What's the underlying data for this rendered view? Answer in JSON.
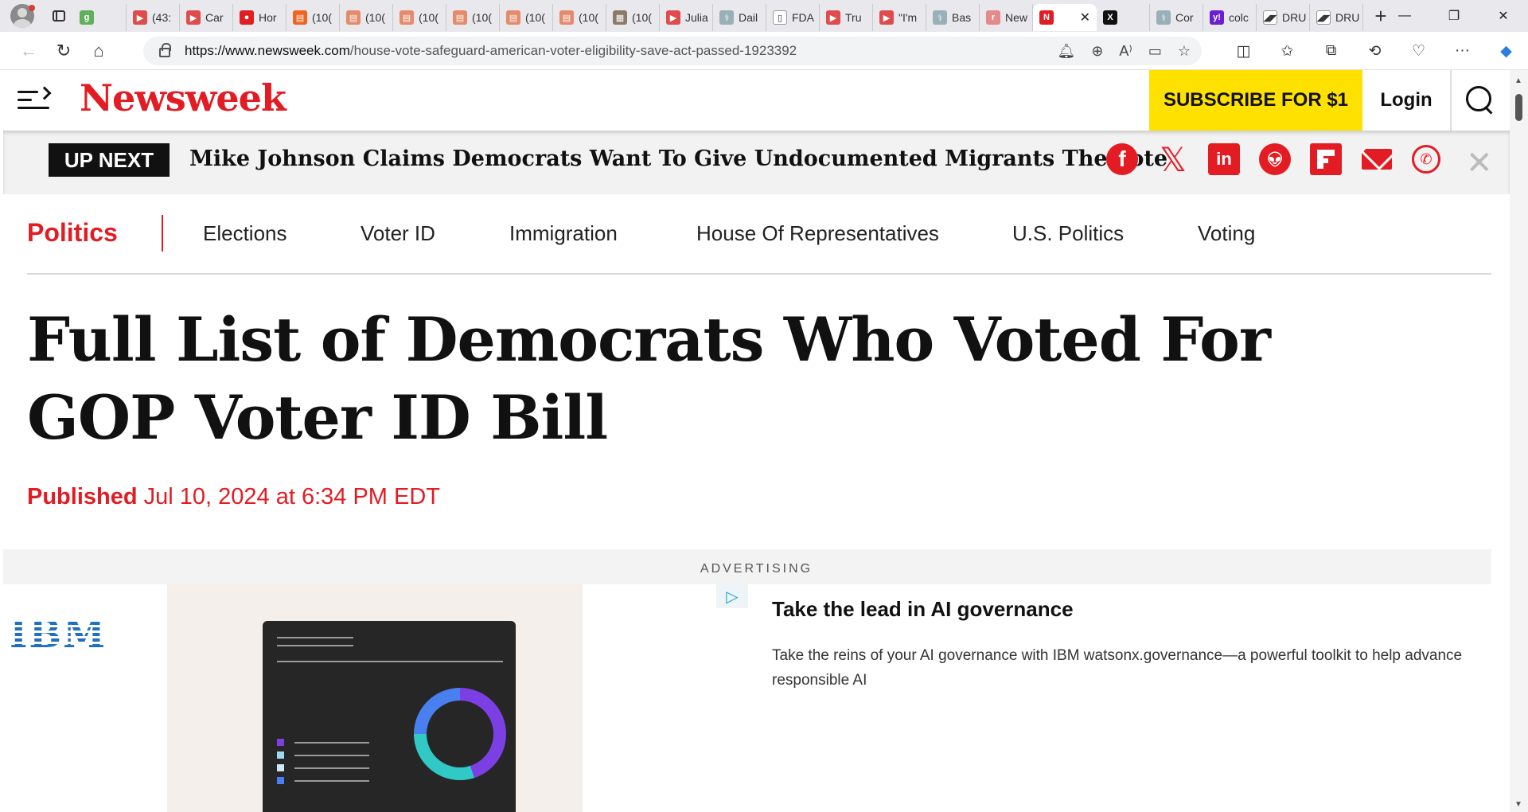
{
  "browser": {
    "tabs": [
      {
        "label": "",
        "fav_color": "#5fb05a",
        "fav_char": "g"
      },
      {
        "label": "(43:",
        "fav_color": "#e04b4b",
        "fav_char": "▶"
      },
      {
        "label": "Car",
        "fav_color": "#e04b4b",
        "fav_char": "▶"
      },
      {
        "label": "Hor",
        "fav_color": "#e02020",
        "fav_char": "●"
      },
      {
        "label": "(10(",
        "fav_color": "#f0641e",
        "fav_char": "▤"
      },
      {
        "label": "(10(",
        "fav_color": "#e58a6a",
        "fav_char": "▤"
      },
      {
        "label": "(10(",
        "fav_color": "#e58a6a",
        "fav_char": "▤"
      },
      {
        "label": "(10(",
        "fav_color": "#e58a6a",
        "fav_char": "▤"
      },
      {
        "label": "(10(",
        "fav_color": "#e58a6a",
        "fav_char": "▤"
      },
      {
        "label": "(10(",
        "fav_color": "#e58a6a",
        "fav_char": "▤"
      },
      {
        "label": "(10(",
        "fav_color": "#8a7a6a",
        "fav_char": "▦"
      },
      {
        "label": "Julia",
        "fav_color": "#e04b4b",
        "fav_char": "▶"
      },
      {
        "label": "Dail",
        "fav_color": "#9ab0b8",
        "fav_char": "⚕"
      },
      {
        "label": "FDA",
        "fav_color": "#ffffff",
        "fav_char": "▯"
      },
      {
        "label": "Tru",
        "fav_color": "#e04b4b",
        "fav_char": "▶"
      },
      {
        "label": "\"I'm",
        "fav_color": "#e04b4b",
        "fav_char": "▶"
      },
      {
        "label": "Bas",
        "fav_color": "#9ab0b8",
        "fav_char": "⚕"
      },
      {
        "label": "New",
        "fav_color": "#e58a8a",
        "fav_char": "r"
      }
    ],
    "active_tab": {
      "label": "N",
      "fav_color": "#e31c23"
    },
    "tabs_after": [
      {
        "label": "",
        "fav_color": "#111111",
        "fav_char": "X"
      },
      {
        "label": "Cor",
        "fav_color": "#9ab0b8",
        "fav_char": "⚕"
      },
      {
        "label": "colc",
        "fav_color": "#6a1fd0",
        "fav_char": "y!"
      },
      {
        "label": "DRU",
        "fav_color": "#ffffff",
        "fav_char": "◢◤"
      },
      {
        "label": "DRU",
        "fav_color": "#ffffff",
        "fav_char": "◢◤"
      }
    ],
    "url_host": "https://www.newsweek.com",
    "url_path": "/house-vote-safeguard-american-voter-eligibility-save-act-passed-1923392"
  },
  "site": {
    "logo": "Newsweek",
    "subscribe_label": "SUBSCRIBE FOR $1",
    "login_label": "Login",
    "accent_color": "#e31c23"
  },
  "upnext": {
    "tag": "UP NEXT",
    "title": "Mike Johnson Claims Democrats Want To Give Undocumented Migrants The Vote"
  },
  "topics": {
    "main": "Politics",
    "items": [
      "Elections",
      "Voter ID",
      "Immigration",
      "House Of Representatives",
      "U.S. Politics",
      "Voting"
    ]
  },
  "article": {
    "headline": "Full List of Democrats Who Voted For GOP Voter ID Bill",
    "published_label": "Published",
    "published_date": "Jul 10, 2024 at 6:34 PM EDT"
  },
  "ad": {
    "label": "ADVERTISING",
    "brand": "IBM",
    "title": "Take the lead in AI governance",
    "body": "Take the reins of your AI governance with IBM watsonx.governance—a powerful toolkit to help advance responsible AI"
  }
}
